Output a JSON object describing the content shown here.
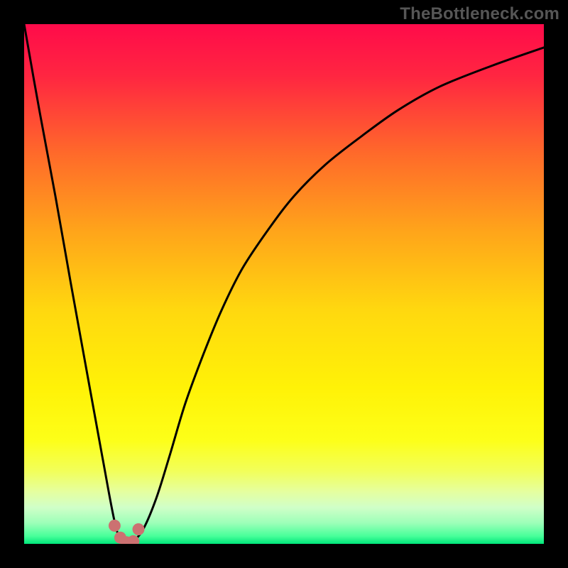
{
  "watermark": "TheBottleneck.com",
  "chart_data": {
    "type": "line",
    "title": "",
    "xlabel": "",
    "ylabel": "",
    "x": [
      0.0,
      0.03,
      0.06,
      0.09,
      0.12,
      0.15,
      0.177,
      0.195,
      0.21,
      0.23,
      0.255,
      0.28,
      0.31,
      0.345,
      0.38,
      0.42,
      0.47,
      0.52,
      0.58,
      0.65,
      0.72,
      0.8,
      0.9,
      1.0
    ],
    "values": [
      1.0,
      0.83,
      0.67,
      0.5,
      0.335,
      0.17,
      0.03,
      0.0,
      0.005,
      0.03,
      0.09,
      0.17,
      0.27,
      0.365,
      0.45,
      0.53,
      0.605,
      0.67,
      0.73,
      0.785,
      0.835,
      0.88,
      0.92,
      0.955
    ],
    "xlim": [
      0,
      1
    ],
    "ylim": [
      0,
      1
    ],
    "annotations": {
      "valley_dots_x": [
        0.174,
        0.185,
        0.197,
        0.21,
        0.22
      ],
      "valley_dots_y": [
        0.035,
        0.012,
        0.003,
        0.005,
        0.028
      ]
    }
  },
  "colors": {
    "gradient_stops": [
      {
        "pos": 0.0,
        "color": "#ff0b4a"
      },
      {
        "pos": 0.1,
        "color": "#ff2641"
      },
      {
        "pos": 0.25,
        "color": "#ff6a2a"
      },
      {
        "pos": 0.4,
        "color": "#ffa51a"
      },
      {
        "pos": 0.55,
        "color": "#ffd80f"
      },
      {
        "pos": 0.7,
        "color": "#fff207"
      },
      {
        "pos": 0.8,
        "color": "#fdff18"
      },
      {
        "pos": 0.86,
        "color": "#f2ff5a"
      },
      {
        "pos": 0.9,
        "color": "#e5ffa0"
      },
      {
        "pos": 0.93,
        "color": "#d0ffc8"
      },
      {
        "pos": 0.96,
        "color": "#9cffb8"
      },
      {
        "pos": 0.985,
        "color": "#48ff9a"
      },
      {
        "pos": 1.0,
        "color": "#00e67a"
      }
    ],
    "dot_color": "#cc7171",
    "curve_color": "#000000",
    "frame_color": "#000000",
    "watermark_color": "#565656"
  }
}
